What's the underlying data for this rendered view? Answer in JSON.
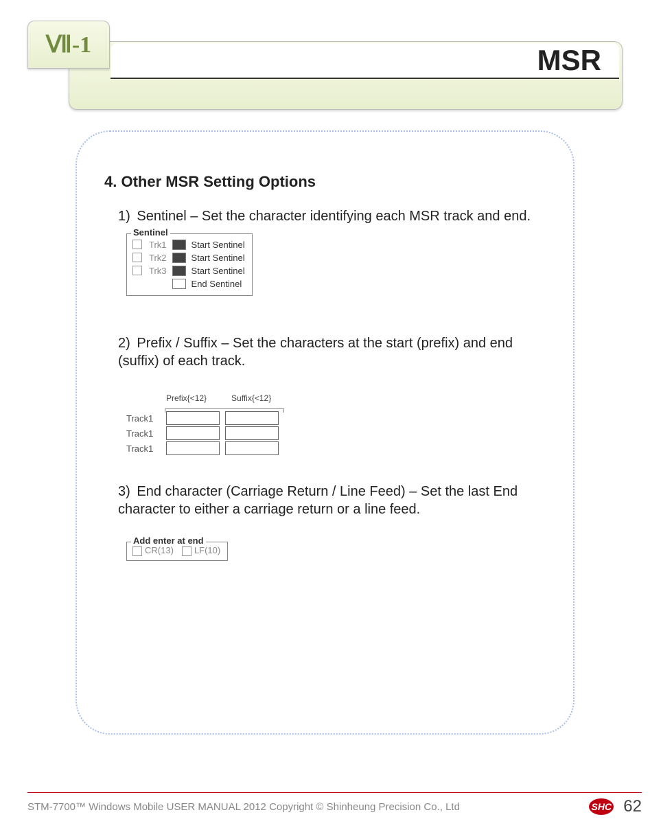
{
  "header": {
    "tab_label": "Ⅶ-1",
    "title": "MSR"
  },
  "content": {
    "section_title": "4. Other MSR Setting Options",
    "items": [
      {
        "num": "1)",
        "text": "Sentinel – Set the character identifying each MSR track and end."
      },
      {
        "num": "2)",
        "text": "Prefix / Suffix – Set the characters at the start (prefix) and end (suffix) of each track."
      },
      {
        "num": "3)",
        "text": "End character (Carriage Return / Line Feed) – Set the last End character to either a carriage return or a line feed."
      }
    ],
    "fig_sentinel": {
      "legend": "Sentinel",
      "rows": [
        "Trk1",
        "Trk2",
        "Trk3"
      ],
      "labels": [
        "Start Sentinel",
        "Start Sentinel",
        "Start Sentinel",
        "End Sentinel"
      ]
    },
    "fig_prefix": {
      "prefix_head": "Prefix{<12}",
      "suffix_head": "Suffix{<12}",
      "rows": [
        "Track1",
        "Track1",
        "Track1"
      ]
    },
    "fig_enter": {
      "legend": "Add enter at end",
      "opt1": "CR(13)",
      "opt2": "LF(10)"
    }
  },
  "footer": {
    "left": "STM-7700™ Windows Mobile USER MANUAL  2012 Copyright © Shinheung Precision Co., Ltd",
    "badge": "SHC",
    "page": "62"
  }
}
